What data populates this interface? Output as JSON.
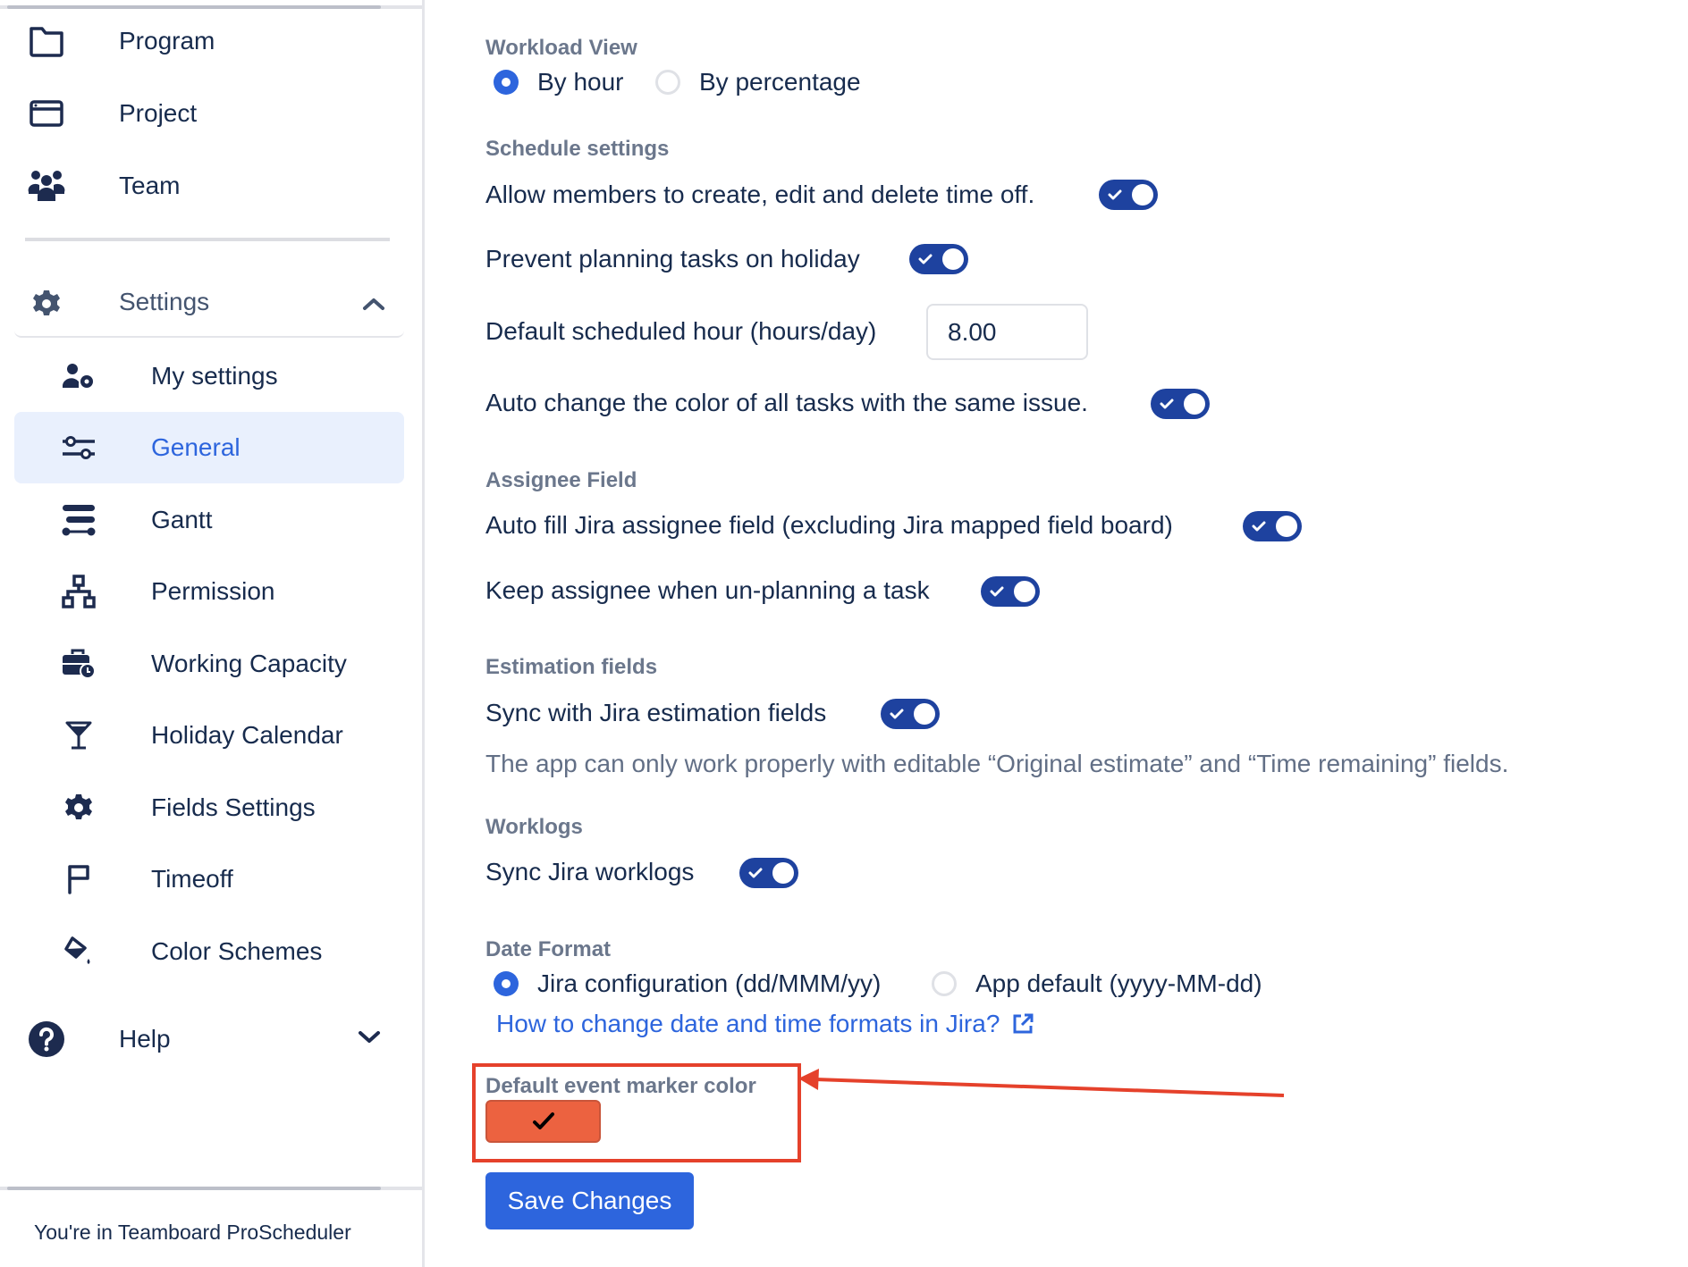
{
  "sidebar": {
    "top_items": [
      {
        "label": "Program",
        "icon": "folder-icon"
      },
      {
        "label": "Project",
        "icon": "browser-window-icon"
      },
      {
        "label": "Team",
        "icon": "team-icon"
      }
    ],
    "settings": {
      "label": "Settings",
      "icon": "gear-icon",
      "expanded": true,
      "items": [
        {
          "label": "My settings",
          "icon": "user-gear-icon",
          "active": false
        },
        {
          "label": "General",
          "icon": "sliders-icon",
          "active": true
        },
        {
          "label": "Gantt",
          "icon": "gantt-icon",
          "active": false
        },
        {
          "label": "Permission",
          "icon": "hierarchy-icon",
          "active": false
        },
        {
          "label": "Working Capacity",
          "icon": "briefcase-clock-icon",
          "active": false
        },
        {
          "label": "Holiday Calendar",
          "icon": "cocktail-icon",
          "active": false
        },
        {
          "label": "Fields Settings",
          "icon": "cog-icon",
          "active": false
        },
        {
          "label": "Timeoff",
          "icon": "flag-icon",
          "active": false
        },
        {
          "label": "Color Schemes",
          "icon": "paint-bucket-icon",
          "active": false
        }
      ]
    },
    "help": {
      "label": "Help",
      "icon": "question-circle-icon",
      "expanded": false
    },
    "footer": "You're in Teamboard ProScheduler"
  },
  "main": {
    "workload_view": {
      "label": "Workload View",
      "options": [
        {
          "label": "By hour",
          "selected": true
        },
        {
          "label": "By percentage",
          "selected": false
        }
      ]
    },
    "schedule_settings": {
      "label": "Schedule settings",
      "allow_members": {
        "label": "Allow members to create, edit and delete time off.",
        "on": true
      },
      "prevent_holiday": {
        "label": "Prevent planning tasks on holiday",
        "on": true
      },
      "default_hour": {
        "label": "Default scheduled hour (hours/day)",
        "value": "8.00"
      },
      "auto_color": {
        "label": "Auto change the color of all tasks with the same issue.",
        "on": true
      }
    },
    "assignee_field": {
      "label": "Assignee Field",
      "auto_fill": {
        "label": "Auto fill Jira assignee field (excluding Jira mapped field board)",
        "on": true
      },
      "keep_assignee": {
        "label": "Keep assignee when un-planning a task",
        "on": true
      }
    },
    "estimation_fields": {
      "label": "Estimation fields",
      "sync": {
        "label": "Sync with Jira estimation fields",
        "on": true
      },
      "note": "The app can only work properly with editable “Original estimate” and “Time remaining” fields."
    },
    "worklogs": {
      "label": "Worklogs",
      "sync": {
        "label": "Sync Jira worklogs",
        "on": true
      }
    },
    "date_format": {
      "label": "Date Format",
      "options": [
        {
          "label": "Jira configuration (dd/MMM/yy)",
          "selected": true
        },
        {
          "label": "App default (yyyy-MM-dd)",
          "selected": false
        }
      ],
      "help_link": "How to change date and time formats in Jira?"
    },
    "event_marker": {
      "label": "Default event marker color",
      "color": "#EC6240"
    },
    "save_label": "Save Changes"
  },
  "colors": {
    "accent": "#2D65DD",
    "toggle_on": "#1E429F",
    "annotation": "#E5412B",
    "active_bg": "#E9F0FD"
  }
}
